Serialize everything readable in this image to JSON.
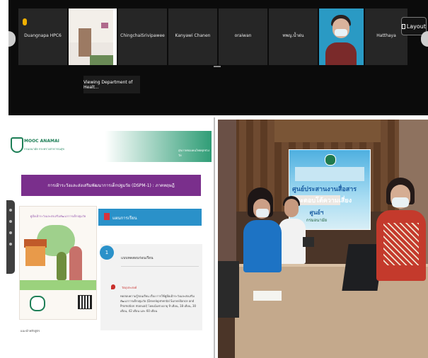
{
  "call": {
    "participants": [
      {
        "name": "Duangnapa HPC6"
      },
      {
        "name": ""
      },
      {
        "name": "ChingchaiSrivipawee"
      },
      {
        "name": "Kanyawi Chanen"
      },
      {
        "name": "oraiwan"
      },
      {
        "name": "ทพญ.น้ำฝน"
      },
      {
        "name": ""
      },
      {
        "name": "Hatthaya"
      }
    ],
    "layout_label": "Layout",
    "viewing_label": "Viewing Department of Healt..."
  },
  "slide": {
    "logo_title": "MOOC ANAMAI",
    "logo_subtitle": "กรมอนามัย กระทรวงสาธารณสุข",
    "header_right": "สุขภาพของคนไทยทุกช่วงวัย",
    "banner": "การเฝ้าระวังและส่งเสริมพัฒนาการเด็กปฐมวัย (DSPM-1) : ภาคทฤษฎี",
    "poster_title": "คู่มือเฝ้าระวังและส่งเสริมพัฒนาการเด็กปฐมวัย",
    "ref": "แนะนำหลักสูตร",
    "tab_label": "แผนการเรียน",
    "lesson_number": "1",
    "lesson_title": "แบบทดสอบก่อนเรียน",
    "objective_label": "วัตถุประสงค์",
    "objective_text": "ทดสอบความรู้ก่อนเรียน เรื่อง การใช้คู่มือเฝ้าระวังและส่งเสริมพัฒนาการเด็กปฐมวัย (Developmental Surveillance and Promotion manual) โดยเน้นช่วงอายุ 9 เดือน, 18 เดือน, 30 เดือน, 42 เดือน และ 60 เดือน"
  },
  "room": {
    "screen_line1": "ศูนย์ประสานงานสื่อสาร",
    "screen_line2": "และตอบโต้ความเสี่ยง",
    "screen_line3": "ศูนย์ฯ",
    "screen_line4": "กรมอนามัย"
  }
}
